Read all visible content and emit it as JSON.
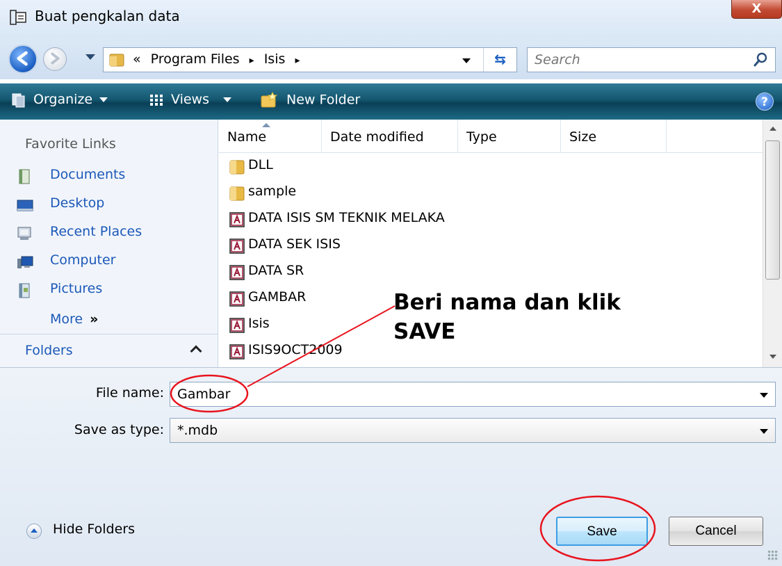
{
  "window": {
    "title": "Buat pengkalan data",
    "close_glyph": "X"
  },
  "address": {
    "chevron": "«",
    "path": [
      "Program Files",
      "Isis"
    ],
    "separator": "▸",
    "search_placeholder": "Search",
    "refresh_glyph": "⇆"
  },
  "toolbar": {
    "organize_label": "Organize",
    "views_label": "Views",
    "new_folder_label": "New Folder",
    "help_glyph": "?"
  },
  "nav": {
    "favorites_heading": "Favorite Links",
    "items": [
      {
        "label": "Documents",
        "icon": "documents-icon"
      },
      {
        "label": "Desktop",
        "icon": "desktop-icon"
      },
      {
        "label": "Recent Places",
        "icon": "recent-places-icon"
      },
      {
        "label": "Computer",
        "icon": "computer-icon"
      },
      {
        "label": "Pictures",
        "icon": "pictures-icon"
      }
    ],
    "more_label": "More",
    "more_glyph": "»",
    "folders_label": "Folders"
  },
  "files": {
    "columns": [
      "Name",
      "Date modified",
      "Type",
      "Size"
    ],
    "rows": [
      {
        "name": "DLL",
        "icon": "folder-icon"
      },
      {
        "name": "sample",
        "icon": "folder-icon"
      },
      {
        "name": "DATA ISIS SM TEKNIK MELAKA",
        "icon": "access-db-icon"
      },
      {
        "name": "DATA SEK ISIS",
        "icon": "access-db-icon"
      },
      {
        "name": "DATA SR",
        "icon": "access-db-icon"
      },
      {
        "name": "GAMBAR",
        "icon": "access-db-icon"
      },
      {
        "name": "Isis",
        "icon": "access-db-icon"
      },
      {
        "name": "ISIS9OCT2009",
        "icon": "access-db-icon"
      }
    ]
  },
  "form": {
    "file_name_label": "File name:",
    "file_name_value": "Gambar",
    "save_type_label": "Save as type:",
    "save_type_value": "*.mdb"
  },
  "footer": {
    "hide_folders_label": "Hide Folders",
    "save_label": "Save",
    "cancel_label": "Cancel"
  },
  "annotation": {
    "text": "Beri nama dan klik\nSAVE",
    "color": "#e8141e"
  },
  "colors": {
    "command_bar": "#14566f",
    "nav_link": "#1c58b8",
    "title_bar": "#dbe8f6"
  }
}
